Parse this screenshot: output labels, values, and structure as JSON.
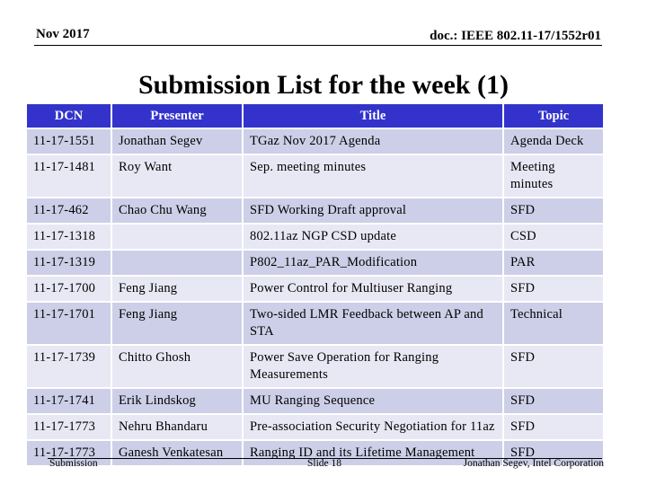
{
  "header": {
    "date": "Nov 2017",
    "doc_id": "doc.: IEEE 802.11-17/1552r01"
  },
  "title": "Submission List for the week (1)",
  "colors": {
    "header_bg": "#3333CC",
    "row_odd_bg": "#CDCFE8",
    "row_even_bg": "#E7E8F4"
  },
  "table": {
    "columns": [
      "DCN",
      "Presenter",
      "Title",
      "Topic"
    ],
    "rows": [
      {
        "dcn": "11-17-1551",
        "presenter": "Jonathan Segev",
        "title": "TGaz Nov 2017 Agenda",
        "topic": "Agenda Deck"
      },
      {
        "dcn": "11-17-1481",
        "presenter": "Roy Want",
        "title": "Sep. meeting minutes",
        "topic": "Meeting minutes"
      },
      {
        "dcn": "11-17-462",
        "presenter": "Chao Chu Wang",
        "title": "SFD Working Draft approval",
        "topic": "SFD"
      },
      {
        "dcn": "11-17-1318",
        "presenter": "",
        "title": "802.11az NGP CSD update",
        "topic": "CSD"
      },
      {
        "dcn": "11-17-1319",
        "presenter": "",
        "title": "P802_11az_PAR_Modification",
        "topic": "PAR"
      },
      {
        "dcn": "11-17-1700",
        "presenter": "Feng Jiang",
        "title": "Power Control for Multiuser Ranging",
        "topic": "SFD"
      },
      {
        "dcn": "11-17-1701",
        "presenter": "Feng Jiang",
        "title": "Two-sided LMR Feedback between AP and STA",
        "topic": "Technical"
      },
      {
        "dcn": "11-17-1739",
        "presenter": "Chitto Ghosh",
        "title": "Power Save Operation for Ranging Measurements",
        "topic": "SFD"
      },
      {
        "dcn": "11-17-1741",
        "presenter": "Erik Lindskog",
        "title": "MU Ranging Sequence",
        "topic": "SFD"
      },
      {
        "dcn": "11-17-1773",
        "presenter": "Nehru Bhandaru",
        "title": "Pre-association Security Negotiation for 11az",
        "topic": "SFD"
      },
      {
        "dcn": "11-17-1773",
        "presenter": "Ganesh Venkatesan",
        "title": "Ranging ID and its Lifetime Management",
        "topic": "SFD"
      }
    ]
  },
  "footer": {
    "left": "Submission",
    "center": "Slide 18",
    "right": "Jonathan Segev, Intel Corporation"
  }
}
